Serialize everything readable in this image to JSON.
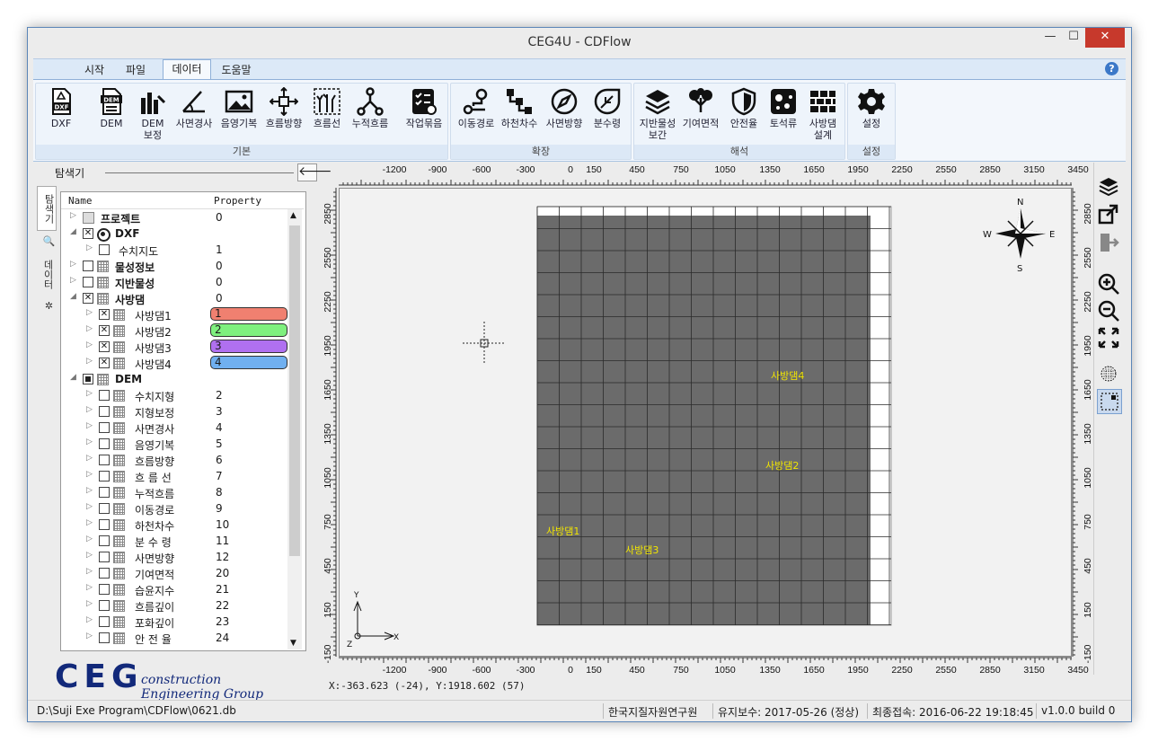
{
  "window": {
    "title": "CEG4U - CDFlow",
    "min": "—",
    "max": "☐",
    "close": "✕"
  },
  "ribbon_tabs": [
    "시작",
    "파일",
    "데이터",
    "도움말"
  ],
  "help": "?",
  "ribbon": {
    "groups": [
      {
        "name": "기본",
        "buttons": [
          "DXF",
          "DEM",
          "DEM\n보정",
          "사면경사",
          "음영기복",
          "흐름방향",
          "흐름선",
          "누적흐름",
          "작업묶음"
        ]
      },
      {
        "name": "확장",
        "buttons": [
          "이동경로",
          "하천차수",
          "사면방향",
          "분수령"
        ]
      },
      {
        "name": "해석",
        "buttons": [
          "지반물성\n보간",
          "기여면적",
          "안전율",
          "토석류",
          "사방댐\n설계"
        ]
      },
      {
        "name": "설정",
        "buttons": [
          "설정"
        ]
      }
    ]
  },
  "explorer": {
    "title": "탐색기",
    "back": "🡐",
    "vtabs": [
      "탐색기",
      "데이터"
    ],
    "columns": [
      "Name",
      "Property"
    ],
    "rows": [
      {
        "name": "프로젝트",
        "prop": "0"
      },
      {
        "name": "DXF",
        "prop": ""
      },
      {
        "name": "수치지도",
        "prop": "1"
      },
      {
        "name": "물성정보",
        "prop": "0"
      },
      {
        "name": "지반물성",
        "prop": "0"
      },
      {
        "name": "사방댐",
        "prop": "0"
      },
      {
        "name": "사방댐1",
        "prop": "1",
        "color": "#f08070"
      },
      {
        "name": "사방댐2",
        "prop": "2",
        "color": "#7ef07e"
      },
      {
        "name": "사방댐3",
        "prop": "3",
        "color": "#b070f0"
      },
      {
        "name": "사방댐4",
        "prop": "4",
        "color": "#70b0f0"
      },
      {
        "name": "DEM",
        "prop": ""
      },
      {
        "name": "수치지형",
        "prop": "2"
      },
      {
        "name": "지형보정",
        "prop": "3"
      },
      {
        "name": "사면경사",
        "prop": "4"
      },
      {
        "name": "음영기복",
        "prop": "5"
      },
      {
        "name": "흐름방향",
        "prop": "6"
      },
      {
        "name": "흐 름 선",
        "prop": "7"
      },
      {
        "name": "누적흐름",
        "prop": "8"
      },
      {
        "name": "이동경로",
        "prop": "9"
      },
      {
        "name": "하천차수",
        "prop": "10"
      },
      {
        "name": "분 수 령",
        "prop": "11"
      },
      {
        "name": "사면방향",
        "prop": "12"
      },
      {
        "name": "기여면적",
        "prop": "20"
      },
      {
        "name": "습윤지수",
        "prop": "21"
      },
      {
        "name": "흐름깊이",
        "prop": "22"
      },
      {
        "name": "포화깊이",
        "prop": "23"
      },
      {
        "name": "안 전 율",
        "prop": "24"
      }
    ]
  },
  "logo": {
    "mark": "CEG",
    "text": "construction Engineering Group"
  },
  "coords_readout": "X:-363.623 (-24), Y:1918.602 (57)",
  "map": {
    "x_ticks": [
      "-1200",
      "-900",
      "-600",
      "-300",
      "0",
      "150",
      "450",
      "750",
      "1050",
      "1350",
      "1650",
      "1950",
      "2250",
      "2550",
      "2850",
      "3150",
      "3450"
    ],
    "y_ticks": [
      "2850",
      "2550",
      "2250",
      "1950",
      "1650",
      "1350",
      "1050",
      "750",
      "450",
      "150",
      "-150"
    ],
    "labels": [
      "사방댐1",
      "사방댐2",
      "사방댐3",
      "사방댐4"
    ],
    "compass": {
      "n": "N",
      "s": "S",
      "e": "E",
      "w": "W"
    },
    "axes": {
      "x": "X",
      "y": "Y",
      "z": "Z"
    },
    "label_color": "#f2e600",
    "grid_fill": "#6b6b6b"
  },
  "status": {
    "path": "D:\\Suji Exe Program\\CDFlow\\0621.db",
    "org": "한국지질자원연구원",
    "maintenance": "유지보수: 2017-05-26 (정상)",
    "last_access": "최종접속: 2016-06-22 19:18:45",
    "version": "v1.0.0 build 0"
  }
}
